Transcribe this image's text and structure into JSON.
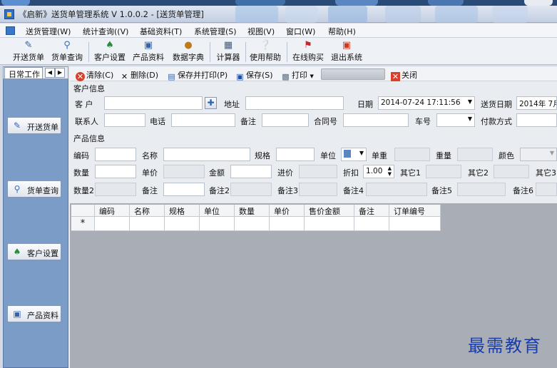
{
  "window": {
    "title": "《启新》送货单管理系统 V 1.0.0.2 - [送货单管理]"
  },
  "menu": [
    "送货管理(W)",
    "统计查询((V)",
    "基础资料(T)",
    "系统管理(S)",
    "视图(V)",
    "窗口(W)",
    "帮助(H)"
  ],
  "toolbar": [
    {
      "label": "开送货单",
      "icon": "pencil-icon"
    },
    {
      "label": "货单查询",
      "icon": "search-icon"
    },
    {
      "label": "客户设置",
      "icon": "customer-icon"
    },
    {
      "label": "产品资料",
      "icon": "product-icon"
    },
    {
      "label": "数据字典",
      "icon": "dictionary-icon"
    },
    {
      "label": "计算器",
      "icon": "calculator-icon"
    },
    {
      "label": "使用帮助",
      "icon": "help-icon"
    },
    {
      "label": "在线购买",
      "icon": "flag-icon"
    },
    {
      "label": "退出系统",
      "icon": "exit-icon"
    }
  ],
  "left_panel": {
    "tab": "日常工作",
    "buttons": [
      {
        "label": "开送货单",
        "icon": "pencil-icon"
      },
      {
        "label": "货单查询",
        "icon": "search-icon"
      },
      {
        "label": "客户设置",
        "icon": "customer-icon"
      },
      {
        "label": "产品资料",
        "icon": "product-icon"
      }
    ]
  },
  "subtoolbar": {
    "clear": "清除(C)",
    "delete": "删除(D)",
    "save_print": "保存并打印(P)",
    "save": "保存(S)",
    "print": "打印",
    "close": "关闭"
  },
  "customer": {
    "section_title": "客户信息",
    "customer_label": "客  户",
    "customer_value": "",
    "address_label": "地址",
    "address_value": "",
    "date_label": "日期",
    "date_value": "2014-07-24 17:11:56",
    "delivery_date_label": "送货日期",
    "delivery_date_value": "2014年 7月",
    "contact_label": "联系人",
    "phone_label": "电话",
    "remark_label": "备注",
    "contract_label": "合同号",
    "car_label": "车号",
    "payment_label": "付款方式"
  },
  "product": {
    "section_title": "产品信息",
    "code": "编码",
    "name": "名称",
    "spec": "规格",
    "unit": "单位",
    "unit_weight": "单重",
    "weight": "重量",
    "color": "颜色",
    "quantity": "数量",
    "price": "单价",
    "amount": "金额",
    "cost_price": "进价",
    "discount": "折扣",
    "discount_value": "1.00",
    "other1": "其它1",
    "other2": "其它2",
    "other3": "其它3",
    "quantity2": "数量2",
    "remark": "备注",
    "remark2": "备注2",
    "remark3": "备注3",
    "remark4": "备注4",
    "remark5": "备注5",
    "remark6": "备注6"
  },
  "grid": {
    "columns": [
      "编码",
      "名称",
      "规格",
      "单位",
      "数量",
      "单价",
      "售价金额",
      "备注",
      "订单编号"
    ],
    "new_row_marker": "*"
  },
  "watermark": "最需教育"
}
